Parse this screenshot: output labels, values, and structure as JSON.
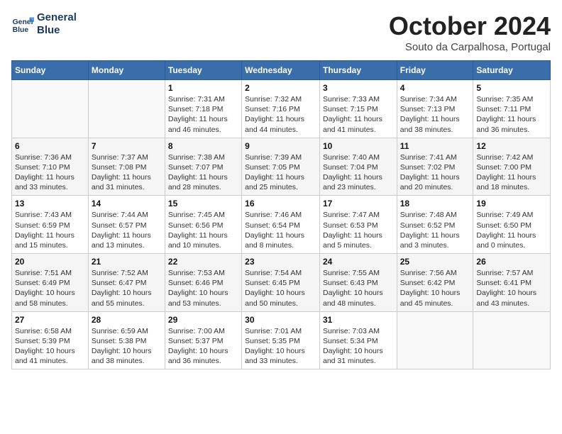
{
  "header": {
    "logo_line1": "General",
    "logo_line2": "Blue",
    "month": "October 2024",
    "location": "Souto da Carpalhosa, Portugal"
  },
  "columns": [
    "Sunday",
    "Monday",
    "Tuesday",
    "Wednesday",
    "Thursday",
    "Friday",
    "Saturday"
  ],
  "weeks": [
    [
      {
        "day": "",
        "info": ""
      },
      {
        "day": "",
        "info": ""
      },
      {
        "day": "1",
        "info": "Sunrise: 7:31 AM\nSunset: 7:18 PM\nDaylight: 11 hours and 46 minutes."
      },
      {
        "day": "2",
        "info": "Sunrise: 7:32 AM\nSunset: 7:16 PM\nDaylight: 11 hours and 44 minutes."
      },
      {
        "day": "3",
        "info": "Sunrise: 7:33 AM\nSunset: 7:15 PM\nDaylight: 11 hours and 41 minutes."
      },
      {
        "day": "4",
        "info": "Sunrise: 7:34 AM\nSunset: 7:13 PM\nDaylight: 11 hours and 38 minutes."
      },
      {
        "day": "5",
        "info": "Sunrise: 7:35 AM\nSunset: 7:11 PM\nDaylight: 11 hours and 36 minutes."
      }
    ],
    [
      {
        "day": "6",
        "info": "Sunrise: 7:36 AM\nSunset: 7:10 PM\nDaylight: 11 hours and 33 minutes."
      },
      {
        "day": "7",
        "info": "Sunrise: 7:37 AM\nSunset: 7:08 PM\nDaylight: 11 hours and 31 minutes."
      },
      {
        "day": "8",
        "info": "Sunrise: 7:38 AM\nSunset: 7:07 PM\nDaylight: 11 hours and 28 minutes."
      },
      {
        "day": "9",
        "info": "Sunrise: 7:39 AM\nSunset: 7:05 PM\nDaylight: 11 hours and 25 minutes."
      },
      {
        "day": "10",
        "info": "Sunrise: 7:40 AM\nSunset: 7:04 PM\nDaylight: 11 hours and 23 minutes."
      },
      {
        "day": "11",
        "info": "Sunrise: 7:41 AM\nSunset: 7:02 PM\nDaylight: 11 hours and 20 minutes."
      },
      {
        "day": "12",
        "info": "Sunrise: 7:42 AM\nSunset: 7:00 PM\nDaylight: 11 hours and 18 minutes."
      }
    ],
    [
      {
        "day": "13",
        "info": "Sunrise: 7:43 AM\nSunset: 6:59 PM\nDaylight: 11 hours and 15 minutes."
      },
      {
        "day": "14",
        "info": "Sunrise: 7:44 AM\nSunset: 6:57 PM\nDaylight: 11 hours and 13 minutes."
      },
      {
        "day": "15",
        "info": "Sunrise: 7:45 AM\nSunset: 6:56 PM\nDaylight: 11 hours and 10 minutes."
      },
      {
        "day": "16",
        "info": "Sunrise: 7:46 AM\nSunset: 6:54 PM\nDaylight: 11 hours and 8 minutes."
      },
      {
        "day": "17",
        "info": "Sunrise: 7:47 AM\nSunset: 6:53 PM\nDaylight: 11 hours and 5 minutes."
      },
      {
        "day": "18",
        "info": "Sunrise: 7:48 AM\nSunset: 6:52 PM\nDaylight: 11 hours and 3 minutes."
      },
      {
        "day": "19",
        "info": "Sunrise: 7:49 AM\nSunset: 6:50 PM\nDaylight: 11 hours and 0 minutes."
      }
    ],
    [
      {
        "day": "20",
        "info": "Sunrise: 7:51 AM\nSunset: 6:49 PM\nDaylight: 10 hours and 58 minutes."
      },
      {
        "day": "21",
        "info": "Sunrise: 7:52 AM\nSunset: 6:47 PM\nDaylight: 10 hours and 55 minutes."
      },
      {
        "day": "22",
        "info": "Sunrise: 7:53 AM\nSunset: 6:46 PM\nDaylight: 10 hours and 53 minutes."
      },
      {
        "day": "23",
        "info": "Sunrise: 7:54 AM\nSunset: 6:45 PM\nDaylight: 10 hours and 50 minutes."
      },
      {
        "day": "24",
        "info": "Sunrise: 7:55 AM\nSunset: 6:43 PM\nDaylight: 10 hours and 48 minutes."
      },
      {
        "day": "25",
        "info": "Sunrise: 7:56 AM\nSunset: 6:42 PM\nDaylight: 10 hours and 45 minutes."
      },
      {
        "day": "26",
        "info": "Sunrise: 7:57 AM\nSunset: 6:41 PM\nDaylight: 10 hours and 43 minutes."
      }
    ],
    [
      {
        "day": "27",
        "info": "Sunrise: 6:58 AM\nSunset: 5:39 PM\nDaylight: 10 hours and 41 minutes."
      },
      {
        "day": "28",
        "info": "Sunrise: 6:59 AM\nSunset: 5:38 PM\nDaylight: 10 hours and 38 minutes."
      },
      {
        "day": "29",
        "info": "Sunrise: 7:00 AM\nSunset: 5:37 PM\nDaylight: 10 hours and 36 minutes."
      },
      {
        "day": "30",
        "info": "Sunrise: 7:01 AM\nSunset: 5:35 PM\nDaylight: 10 hours and 33 minutes."
      },
      {
        "day": "31",
        "info": "Sunrise: 7:03 AM\nSunset: 5:34 PM\nDaylight: 10 hours and 31 minutes."
      },
      {
        "day": "",
        "info": ""
      },
      {
        "day": "",
        "info": ""
      }
    ]
  ]
}
